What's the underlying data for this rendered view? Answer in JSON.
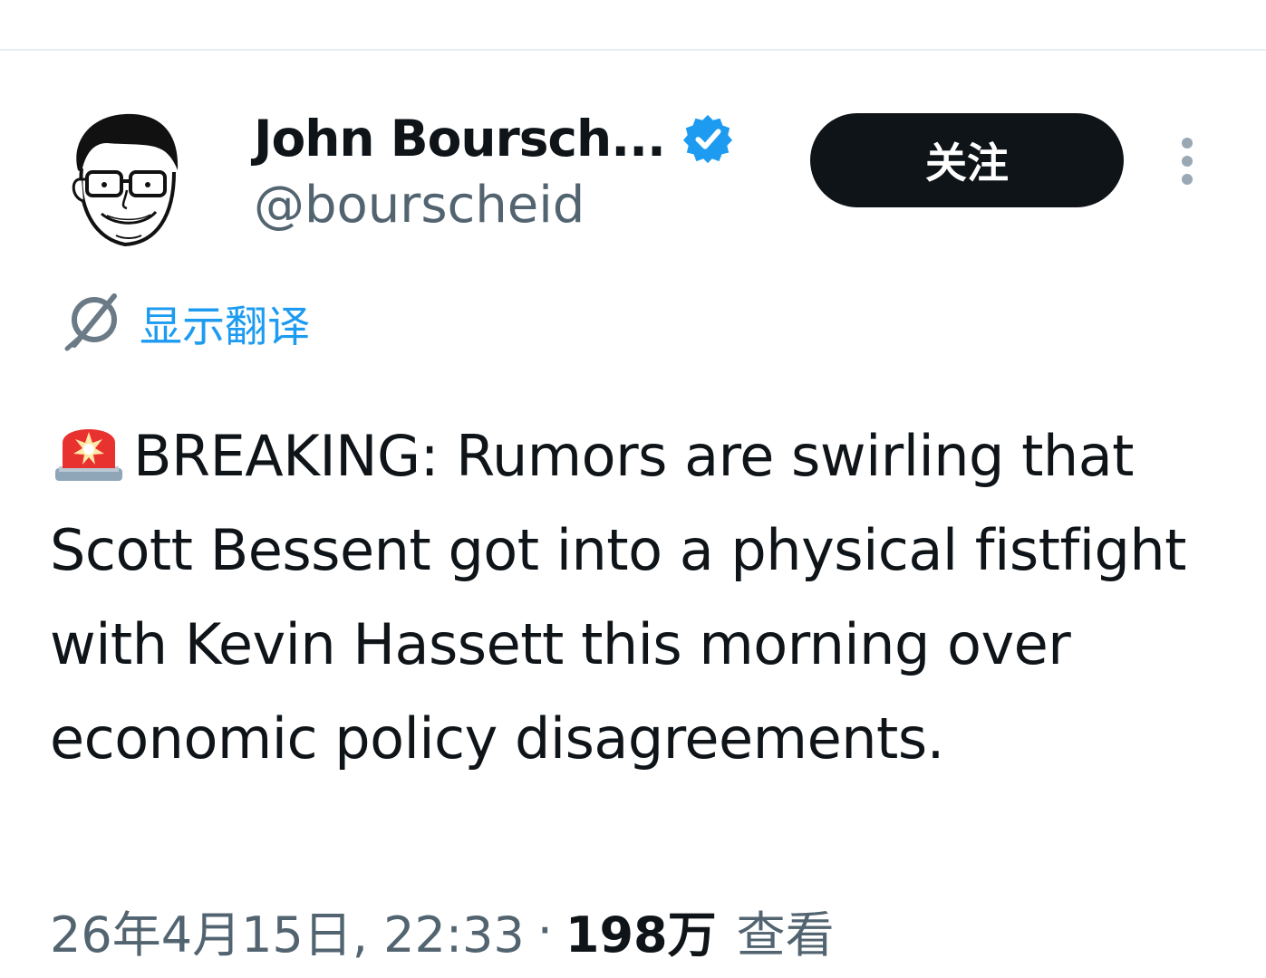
{
  "author": {
    "display_name": "John Boursch...",
    "handle": "@bourscheid",
    "verified": true
  },
  "follow_button": {
    "label": "关注"
  },
  "translate": {
    "label": "显示翻译"
  },
  "tweet": {
    "text": "BREAKING: Rumors are swirling that Scott Bessent got into a physical fistfight with Kevin Hassett this morning over economic policy disagreements.",
    "leading_emoji": "rotating-light-siren-icon"
  },
  "meta": {
    "timestamp": "26年4月15日, 22:33",
    "separator": "·",
    "views_count": "198万",
    "views_label": "查看"
  },
  "colors": {
    "text_primary": "#0f1419",
    "text_secondary": "#536471",
    "accent_blue": "#1d9bf0",
    "follow_button_bg": "#0f1419",
    "follow_button_text": "#ffffff"
  },
  "icons": {
    "verified": "verified-badge-icon",
    "more": "more-vertical-icon",
    "translate": "globe-translate-icon",
    "siren": "siren-icon"
  }
}
